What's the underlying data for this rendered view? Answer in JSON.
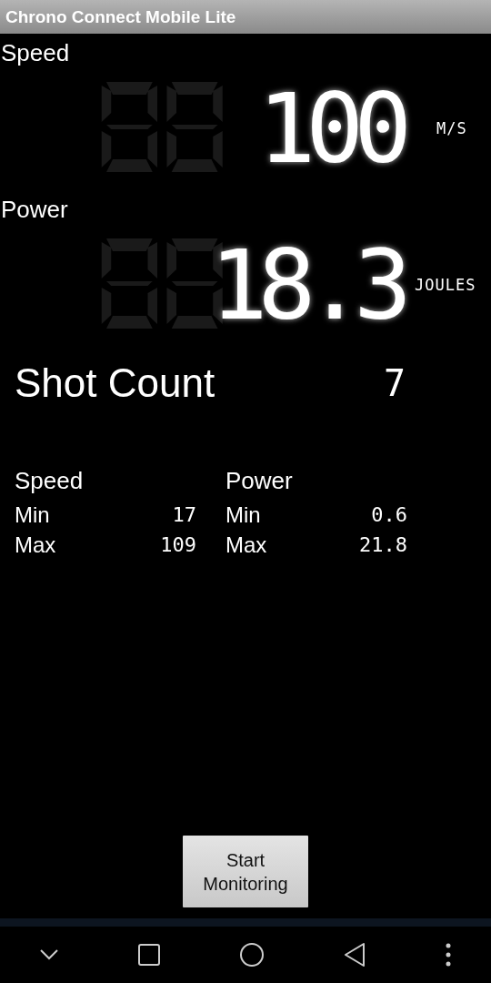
{
  "title_bar": {
    "title": "Chrono Connect Mobile Lite"
  },
  "readings": [
    {
      "label": "Speed",
      "value": "100",
      "unit": "M/S"
    },
    {
      "label": "Power",
      "value": "18.3",
      "unit": "JOULES"
    }
  ],
  "shot_count": {
    "label": "Shot Count",
    "value": "7"
  },
  "stats": [
    {
      "heading": "Speed",
      "rows": [
        {
          "label": "Min",
          "value": "17"
        },
        {
          "label": "Max",
          "value": "109"
        }
      ]
    },
    {
      "heading": "Power",
      "rows": [
        {
          "label": "Min",
          "value": "0.6"
        },
        {
          "label": "Max",
          "value": "21.8"
        }
      ]
    }
  ],
  "button": {
    "label": "Start Monitoring"
  }
}
